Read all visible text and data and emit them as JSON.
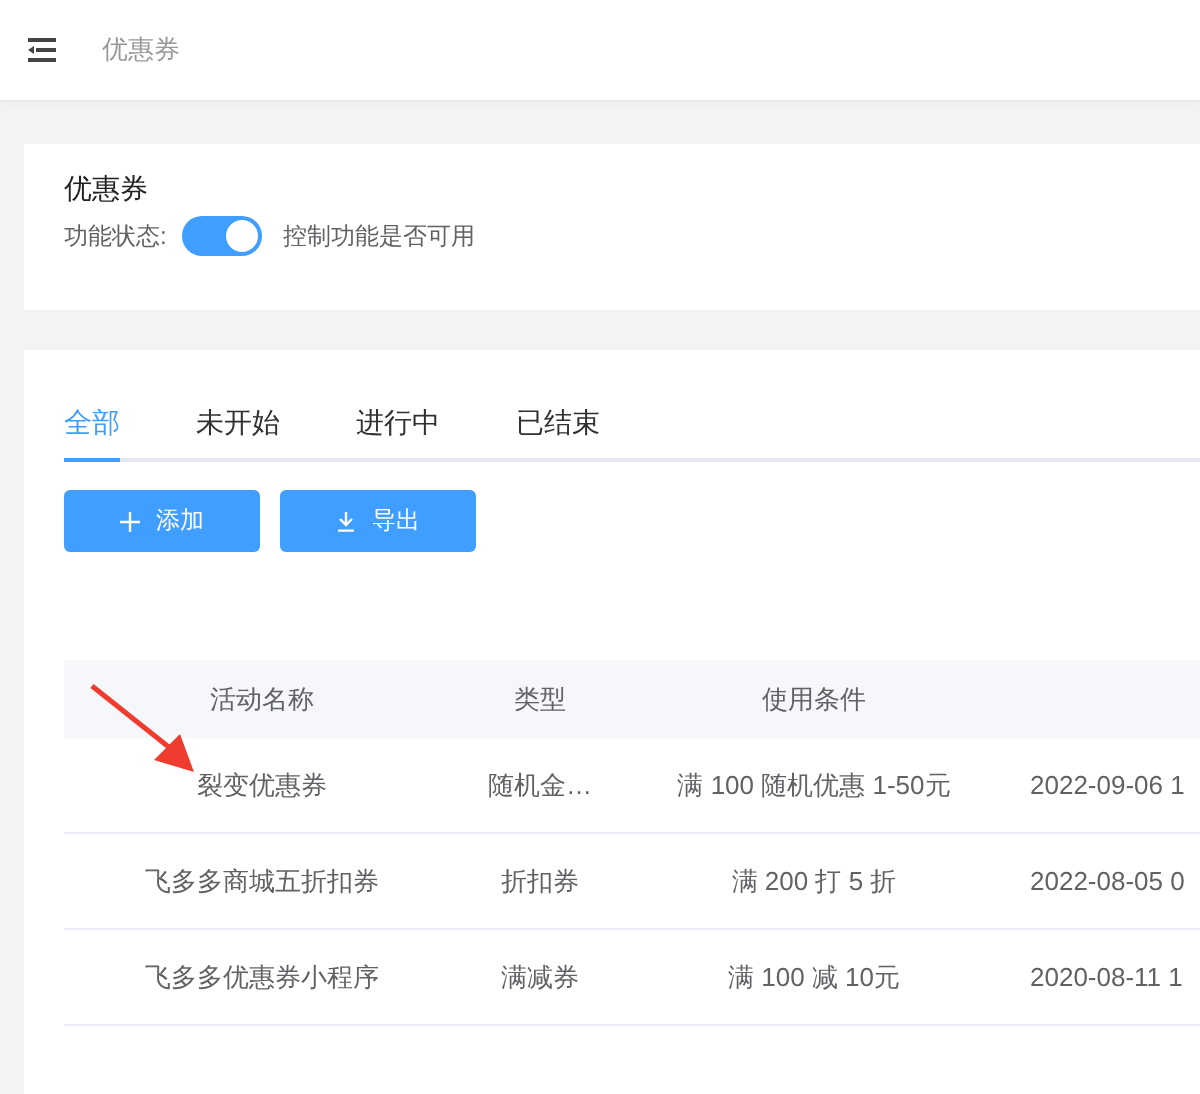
{
  "header": {
    "breadcrumb": "优惠券"
  },
  "feature_card": {
    "title": "优惠券",
    "status_label": "功能状态:",
    "toggle": {
      "on": true
    },
    "hint": "控制功能是否可用"
  },
  "tabs": [
    {
      "label": "全部",
      "selected": true
    },
    {
      "label": "未开始",
      "selected": false
    },
    {
      "label": "进行中",
      "selected": false
    },
    {
      "label": "已结束",
      "selected": false
    }
  ],
  "buttons": [
    {
      "kind": "add",
      "label": "添加"
    },
    {
      "kind": "export",
      "label": "导出"
    }
  ],
  "table": {
    "columns": [
      "活动名称",
      "类型",
      "使用条件"
    ],
    "rows": [
      [
        "裂变优惠券",
        "随机金…",
        "满 100 随机优惠 1-50元",
        "2022-09-06 1"
      ],
      [
        "飞多多商城五折扣券",
        "折扣券",
        "满 200 打 5 折",
        "2022-08-05 0"
      ],
      [
        "飞多多优惠券小程序",
        "满减券",
        "满 100 减 10元",
        "2020-08-11 1"
      ]
    ]
  }
}
